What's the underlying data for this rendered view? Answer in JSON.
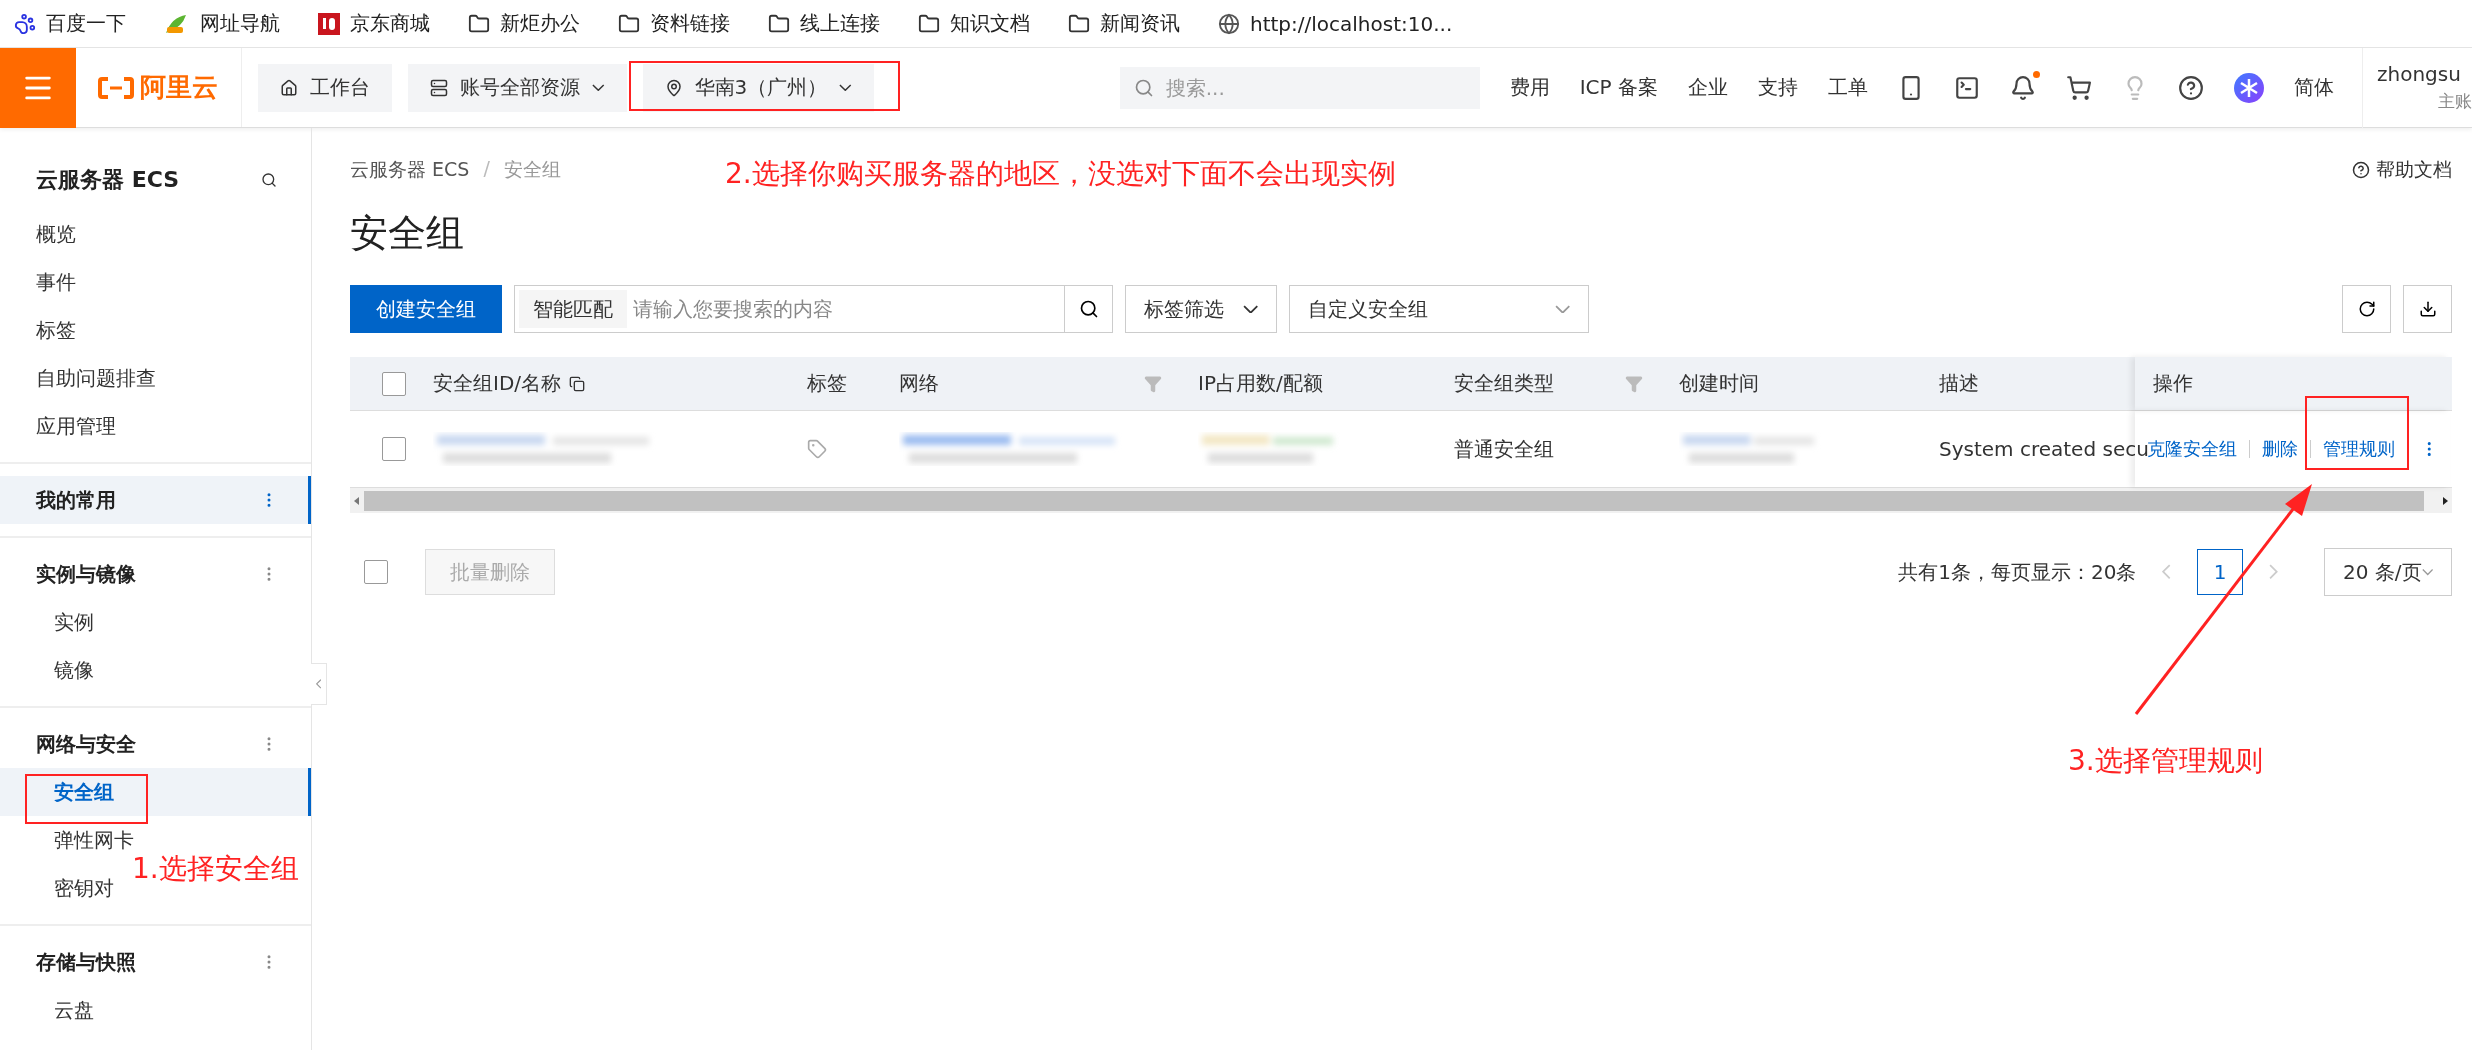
{
  "bookmarks": [
    {
      "label": "百度一下",
      "kind": "paw"
    },
    {
      "label": "网址导航",
      "kind": "leaf"
    },
    {
      "label": "京东商城",
      "kind": "shop"
    },
    {
      "label": "新炬办公",
      "kind": "folder"
    },
    {
      "label": "资料链接",
      "kind": "folder"
    },
    {
      "label": "线上连接",
      "kind": "folder"
    },
    {
      "label": "知识文档",
      "kind": "folder"
    },
    {
      "label": "新闻资讯",
      "kind": "folder"
    },
    {
      "label": "http://localhost:10...",
      "kind": "globe"
    }
  ],
  "header": {
    "logo_text": "阿里云",
    "nav": [
      {
        "label": "工作台",
        "kind": "home"
      },
      {
        "label": "账号全部资源",
        "kind": "stack"
      },
      {
        "label": "华南3（广州）",
        "kind": "pin"
      }
    ],
    "search": {
      "placeholder": "搜索..."
    },
    "links": [
      "费用",
      "ICP 备案",
      "企业",
      "支持",
      "工单"
    ],
    "tools": [
      {
        "kind": "app"
      },
      {
        "kind": "terminal"
      },
      {
        "kind": "bell",
        "unread": true
      },
      {
        "kind": "cart"
      },
      {
        "kind": "bulb"
      },
      {
        "kind": "help"
      },
      {
        "kind": "avatar"
      }
    ],
    "language": "简体",
    "user": {
      "name": "zhongsu",
      "role": "主账"
    }
  },
  "sidebar": {
    "title": "云服务器 ECS",
    "top_items": [
      "概览",
      "事件",
      "标签",
      "自助问题排查",
      "应用管理"
    ],
    "sections": [
      {
        "title": "我的常用",
        "selected": true
      },
      {
        "title": "实例与镜像",
        "selected": false,
        "items": [
          {
            "label": "实例",
            "selected": false
          },
          {
            "label": "镜像",
            "selected": false
          }
        ]
      },
      {
        "title": "网络与安全",
        "selected": false,
        "items": [
          {
            "label": "安全组",
            "selected": true
          },
          {
            "label": "弹性网卡",
            "selected": false
          },
          {
            "label": "密钥对",
            "selected": false
          }
        ]
      },
      {
        "title": "存储与快照",
        "selected": false,
        "items": [
          {
            "label": "云盘",
            "selected": false
          }
        ]
      }
    ]
  },
  "breadcrumb": {
    "items": [
      "云服务器 ECS",
      "安全组"
    ],
    "separator": "/"
  },
  "help_link": "帮助文档",
  "page_title": "安全组",
  "toolbar": {
    "create_button": "创建安全组",
    "search_prefix": "智能匹配",
    "search_placeholder": "请输入您要搜索的内容",
    "tag_filter": "标签筛选",
    "type_select": "自定义安全组"
  },
  "table": {
    "select_all_checked": false,
    "columns": [
      "安全组ID/名称",
      "标签",
      "网络",
      "IP占用数/配额",
      "安全组类型",
      "创建时间",
      "描述",
      "操作"
    ],
    "rows": [
      {
        "checked": false,
        "cells": [
          {
            "kind": "redacted"
          },
          {
            "kind": "tag"
          },
          {
            "kind": "redacted-link"
          },
          {
            "kind": "redacted"
          },
          {
            "kind": "text",
            "text": "普通安全组"
          },
          {
            "kind": "redacted"
          },
          {
            "kind": "text",
            "text": "System created secu"
          }
        ],
        "actions": [
          "克隆安全组",
          "删除",
          "管理规则"
        ]
      }
    ]
  },
  "footer": {
    "select_all_checked": false,
    "batch_delete": {
      "label": "批量删除",
      "disabled": true
    }
  },
  "pagination": {
    "summary": "共有1条，每页显示：20条",
    "pages": [
      {
        "label": "1",
        "selected": true
      }
    ],
    "prev_disabled": true,
    "next_disabled": true,
    "page_size": "20 条/页"
  },
  "annotations": [
    {
      "kind": "box"
    },
    {
      "kind": "note",
      "text": "2.选择你购买服务器的地区，没选对下面不会出现实例"
    },
    {
      "kind": "box"
    },
    {
      "kind": "note",
      "text": "1.选择安全组"
    },
    {
      "kind": "box"
    },
    {
      "kind": "arrow"
    },
    {
      "kind": "note",
      "text": "3.选择管理规则"
    }
  ]
}
